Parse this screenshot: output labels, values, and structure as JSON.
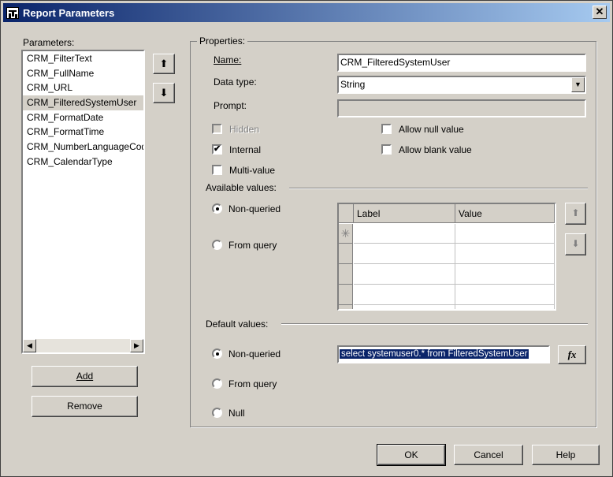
{
  "window": {
    "title": "Report Parameters",
    "close_glyph": "✕"
  },
  "parameters": {
    "label": "Parameters:",
    "items": [
      "CRM_FilterText",
      "CRM_FullName",
      "CRM_URL",
      "CRM_FilteredSystemUser",
      "CRM_FormatDate",
      "CRM_FormatTime",
      "CRM_NumberLanguageCode",
      "CRM_CalendarType"
    ],
    "selected_index": 3,
    "move_up_glyph": "⬆",
    "move_down_glyph": "⬇",
    "add_label": "Add",
    "remove_label": "Remove",
    "scroll_left_glyph": "◀",
    "scroll_right_glyph": "▶"
  },
  "properties": {
    "title": "Properties:",
    "name_label": "Name:",
    "name_value": "CRM_FilteredSystemUser",
    "datatype_label": "Data type:",
    "datatype_value": "String",
    "dropdown_glyph": "▼",
    "prompt_label": "Prompt:",
    "prompt_value": "",
    "hidden_label": "Hidden",
    "hidden_checked": false,
    "internal_label": "Internal",
    "internal_checked": true,
    "checkmark": "✔",
    "multivalue_label": "Multi-value",
    "allow_null_label": "Allow null value",
    "allow_blank_label": "Allow blank value"
  },
  "available_values": {
    "title": "Available values:",
    "option_nonqueried": "Non-queried",
    "option_fromquery": "From query",
    "selected": "Non-queried",
    "columns": [
      "Label",
      "Value"
    ],
    "new_row_glyph": "✳",
    "up_glyph": "⬆",
    "down_glyph": "⬇"
  },
  "default_values": {
    "title": "Default values:",
    "option_nonqueried": "Non-queried",
    "option_fromquery": "From query",
    "option_null": "Null",
    "selected": "Non-queried",
    "expression": "select systemuser0.* from FilteredSystemUser",
    "fx_label": "fx"
  },
  "footer": {
    "ok_label": "OK",
    "cancel_label": "Cancel",
    "help_label": "Help"
  },
  "colors": {
    "face": "#d4d0c8",
    "titlebar": "#0a246a",
    "selection": "#0a246a"
  },
  "icons": {
    "app": "report-app-icon"
  }
}
